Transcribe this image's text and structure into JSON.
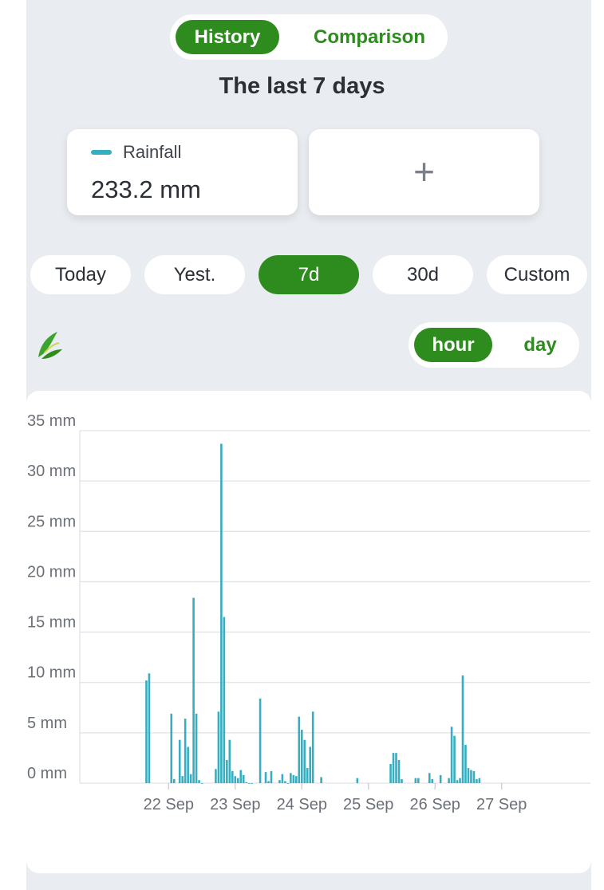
{
  "tabs": {
    "history": "History",
    "comparison": "Comparison"
  },
  "title": "The last 7 days",
  "rain_card": {
    "label": "Rainfall",
    "value": "233.2 mm",
    "color": "#35aec1"
  },
  "add_card": {
    "plus": "+"
  },
  "ranges": [
    "Today",
    "Yest.",
    "7d",
    "30d",
    "Custom"
  ],
  "active_range": "7d",
  "granularity": {
    "hour": "hour",
    "day": "day",
    "active": "hour"
  },
  "colors": {
    "accent": "#2e8b1e",
    "bar": "#35aec1",
    "grid": "#dfe2e6"
  },
  "chart_data": {
    "type": "bar",
    "title": "",
    "ylabel": "",
    "ylim": [
      0,
      35
    ],
    "yticks": [
      "0 mm",
      "5 mm",
      "10 mm",
      "15 mm",
      "20 mm",
      "25 mm",
      "30 mm",
      "35 mm"
    ],
    "xticks": [
      "22 Sep",
      "23 Sep",
      "24 Sep",
      "25 Sep",
      "26 Sep",
      "27 Sep"
    ],
    "x_domain_hours": [
      -32,
      152
    ],
    "series": [
      {
        "x": [
          -8,
          -7,
          1,
          2,
          4,
          5,
          6,
          7,
          8,
          9,
          10,
          11,
          12,
          17,
          18,
          19,
          20,
          21,
          22,
          23,
          24,
          25,
          26,
          27,
          28,
          29,
          30,
          33,
          35,
          36,
          37,
          40,
          41,
          42,
          43,
          44,
          45,
          46,
          47,
          48,
          49,
          50,
          51,
          52,
          55,
          68,
          80,
          81,
          82,
          83,
          84,
          89,
          90,
          94,
          95,
          98,
          101,
          102,
          103,
          104,
          105,
          106,
          107,
          108,
          109,
          110,
          111,
          112
        ],
        "values": [
          10.2,
          10.9,
          6.9,
          0.4,
          4.3,
          0.7,
          6.4,
          3.6,
          0.9,
          18.4,
          6.9,
          0.3,
          0.0,
          1.4,
          7.1,
          33.7,
          16.5,
          2.3,
          4.3,
          1.2,
          0.7,
          0.5,
          1.3,
          0.8,
          0.1,
          0.0,
          0.0,
          8.4,
          1.1,
          0.2,
          1.2,
          0.3,
          0.9,
          0.2,
          0.0,
          1.0,
          0.8,
          0.7,
          6.6,
          5.3,
          4.3,
          1.5,
          3.6,
          7.1,
          0.6,
          0.5,
          1.9,
          3.0,
          3.0,
          2.3,
          0.4,
          0.5,
          0.5,
          1.0,
          0.4,
          0.8,
          0.5,
          5.6,
          4.7,
          0.3,
          0.5,
          10.7,
          3.8,
          1.5,
          1.3,
          1.2,
          0.4,
          0.5
        ]
      }
    ]
  }
}
